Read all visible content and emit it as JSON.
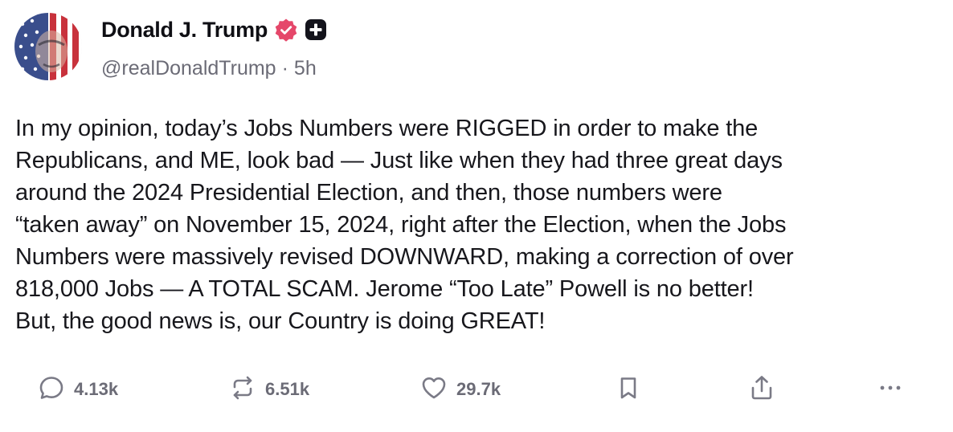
{
  "author": {
    "display_name": "Donald J. Trump",
    "handle": "@realDonaldTrump",
    "separator": "·",
    "time": "5h",
    "avatar_icon": "american-flag-portrait-avatar",
    "verified_color": "#e5476a"
  },
  "post": {
    "text": "In my opinion, today’s Jobs Numbers were RIGGED in order to make the\nRepublicans, and ME, look bad — Just like when they had three great days\naround the 2024 Presidential Election, and then, those numbers were\n“taken away” on November 15, 2024, right after the Election, when the Jobs\nNumbers were massively revised DOWNWARD, making a correction of over\n818,000 Jobs — A TOTAL SCAM. Jerome “Too Late” Powell is no better!\nBut, the good news is, our Country is doing GREAT!"
  },
  "actions": {
    "replies": "4.13k",
    "reposts": "6.51k",
    "likes": "29.7k",
    "icons": [
      "reply-icon",
      "repost-icon",
      "heart-icon",
      "bookmark-icon",
      "share-icon",
      "more-icon"
    ]
  },
  "colors": {
    "text": "#17171c",
    "muted": "#6b6b76",
    "icon": "#7a7a86"
  }
}
